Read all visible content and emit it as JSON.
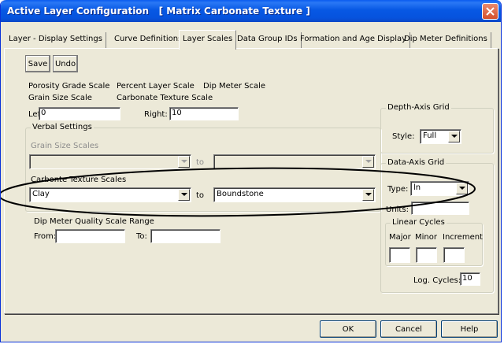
{
  "window": {
    "title": "Active Layer Configuration   [ Matrix Carbonate Texture ]"
  },
  "tabs": [
    {
      "label": "Layer - Display Settings",
      "active": false
    },
    {
      "label": "Curve Definitions",
      "active": false
    },
    {
      "label": "Layer Scales",
      "active": true
    },
    {
      "label": "Data Group IDs",
      "active": false
    },
    {
      "label": "Formation and Age Display",
      "active": false
    },
    {
      "label": "Dip Meter Definitions",
      "active": false
    }
  ],
  "toolbar": {
    "save_label": "Save",
    "undo_label": "Undo"
  },
  "scales": {
    "porosity_label": "Porosity Grade Scale",
    "percent_label": "Percent Layer Scale",
    "dipmeter_label": "Dip Meter Scale",
    "grainsize_label": "Grain Size Scale",
    "carbonate_label": "Carbonate Texture Scale",
    "left_label": "Left:",
    "left_value": "0",
    "right_label": "Right:",
    "right_value": "10"
  },
  "verbal": {
    "group_title": "Verbal Settings",
    "grain_label": "Grain Size Scales",
    "grain_from": "",
    "grain_to": "",
    "to_label": "to",
    "carb_label": "Carbonte Texture Scales",
    "carb_from": "Clay",
    "carb_to": "Boundstone"
  },
  "dip_quality": {
    "label": "Dip Meter Quality Scale Range",
    "from_label": "From:",
    "from_value": "",
    "to_label": "To:",
    "to_value": ""
  },
  "depth_axis": {
    "group_title": "Depth-Axis Grid",
    "style_label": "Style:",
    "style_value": "Full"
  },
  "data_axis": {
    "group_title": "Data-Axis Grid",
    "type_label": "Type:",
    "type_value": "ln",
    "units_label": "Units:",
    "units_value": "",
    "linear_title": "Linear Cycles",
    "major_label": "Major",
    "minor_label": "Minor",
    "increment_label": "Increment",
    "major_value": "",
    "minor_value": "",
    "increment_value": "",
    "log_label": "Log. Cycles:",
    "log_value": "10"
  },
  "footer": {
    "ok_label": "OK",
    "cancel_label": "Cancel",
    "help_label": "Help"
  },
  "colors": {
    "titlebar": "#0758e4",
    "face": "#ece9d8",
    "close": "#d6502b"
  }
}
